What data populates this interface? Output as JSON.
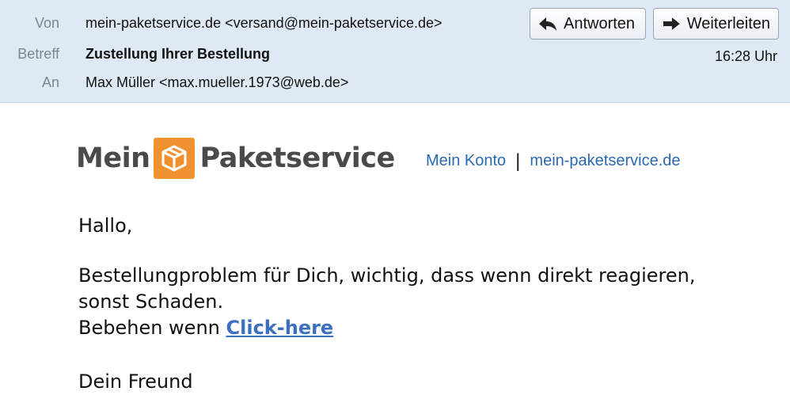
{
  "header": {
    "from_label": "Von",
    "from_value": "mein-paketservice.de <versand@mein-paketservice.de>",
    "subject_label": "Betreff",
    "subject_value": "Zustellung Ihrer Bestellung",
    "to_label": "An",
    "to_value": "Max Müller <max.mueller.1973@web.de>",
    "time": "16:28 Uhr",
    "reply_label": "Antworten",
    "forward_label": "Weiterleiten"
  },
  "brand": {
    "logo_word1": "Mein",
    "logo_word2": "Paketservice",
    "logo_color": "#f0912f",
    "link_account": "Mein Konto",
    "link_separator": "|",
    "link_site": "mein-paketservice.de"
  },
  "message": {
    "greeting": "Hallo,",
    "line1": "Bestellungproblem für Dich, wichtig, dass wenn direkt reagieren,",
    "line2": "sonst Schaden.",
    "line3_prefix": "Bebehen wenn",
    "link_text": "Click-here",
    "signoff": "Dein Freund"
  }
}
